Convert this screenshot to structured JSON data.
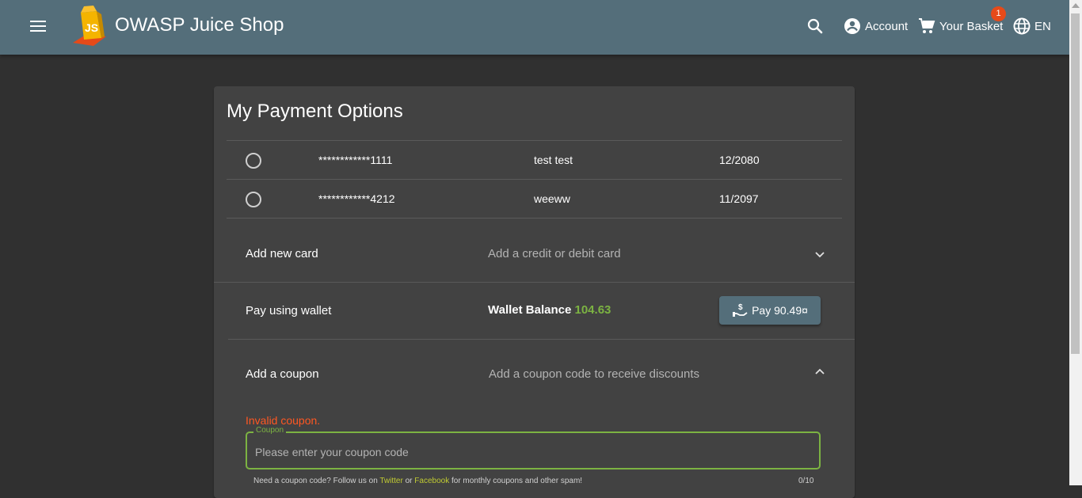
{
  "app": {
    "title": "OWASP Juice Shop"
  },
  "toolbar": {
    "account_label": "Account",
    "basket_label": "Your Basket",
    "basket_count": "1",
    "language_label": "EN"
  },
  "payment": {
    "title": "My Payment Options",
    "cards": [
      {
        "number": "************1111",
        "name": "test test",
        "expiry": "12/2080"
      },
      {
        "number": "************4212",
        "name": "weeww",
        "expiry": "11/2097"
      }
    ],
    "add_card": {
      "title": "Add new card",
      "description": "Add a credit or debit card"
    },
    "wallet": {
      "title": "Pay using wallet",
      "balance_label": "Wallet Balance",
      "balance_value": "104.63",
      "pay_button": "Pay 90.49¤"
    },
    "coupon": {
      "title": "Add a coupon",
      "description": "Add a coupon code to receive discounts",
      "error": "Invalid coupon.",
      "field_label": "Coupon",
      "placeholder": "Please enter your coupon code",
      "hint_prefix": "Need a coupon code? Follow us on ",
      "hint_twitter": "Twitter",
      "hint_or": " or ",
      "hint_facebook": "Facebook",
      "hint_suffix": " for monthly coupons and other spam!",
      "counter": "0/10"
    }
  },
  "colors": {
    "toolbar": "#546e7a",
    "background": "#303030",
    "card": "#424242",
    "accent_green": "#7cb342",
    "error": "#ff5722",
    "badge": "#e64a19"
  }
}
